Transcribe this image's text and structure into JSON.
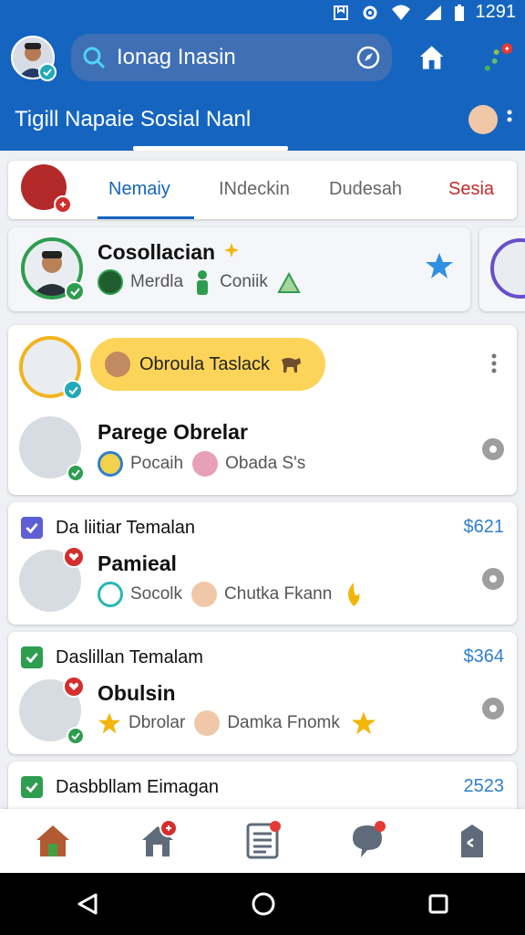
{
  "status_bar": {
    "time": "1291"
  },
  "app_bar": {
    "search_text": "Ionag Inasin"
  },
  "title_bar": {
    "title": "Tigill Napaie Sosial Nanl"
  },
  "tabs": [
    "Nemaiy",
    "INdeckin",
    "Dudesah",
    "Sesia"
  ],
  "story": {
    "name": "Cosollacian",
    "items": [
      "Merdla",
      "Coniik"
    ]
  },
  "post": {
    "pill_text": "Obroula Taslack",
    "name": "Parege Obrelar",
    "items": [
      "Pocaih",
      "Obada S's"
    ]
  },
  "feed": [
    {
      "header": "Da  liitiar Temalan",
      "amount": "$621",
      "name": "Pamieal",
      "items": [
        "Socolk",
        "Chutka Fkann"
      ]
    },
    {
      "header": "Daslillan Temalam",
      "amount": "$364",
      "name": "Obulsin",
      "items": [
        "Dbrolar",
        "Damka Fnomk"
      ]
    },
    {
      "header": "Dasbbllam Eimagan",
      "amount": "2523"
    }
  ],
  "colors": {
    "primary": "#1565c0",
    "accent_red": "#c62828",
    "pill_yellow": "#fdd45a",
    "online_green": "#2e9d4f"
  },
  "icons": [
    "search-icon",
    "compass-icon",
    "home-icon",
    "dots-icon",
    "star-icon",
    "pin-icon",
    "check-icon",
    "back-icon",
    "circle-home-icon",
    "recents-icon"
  ]
}
